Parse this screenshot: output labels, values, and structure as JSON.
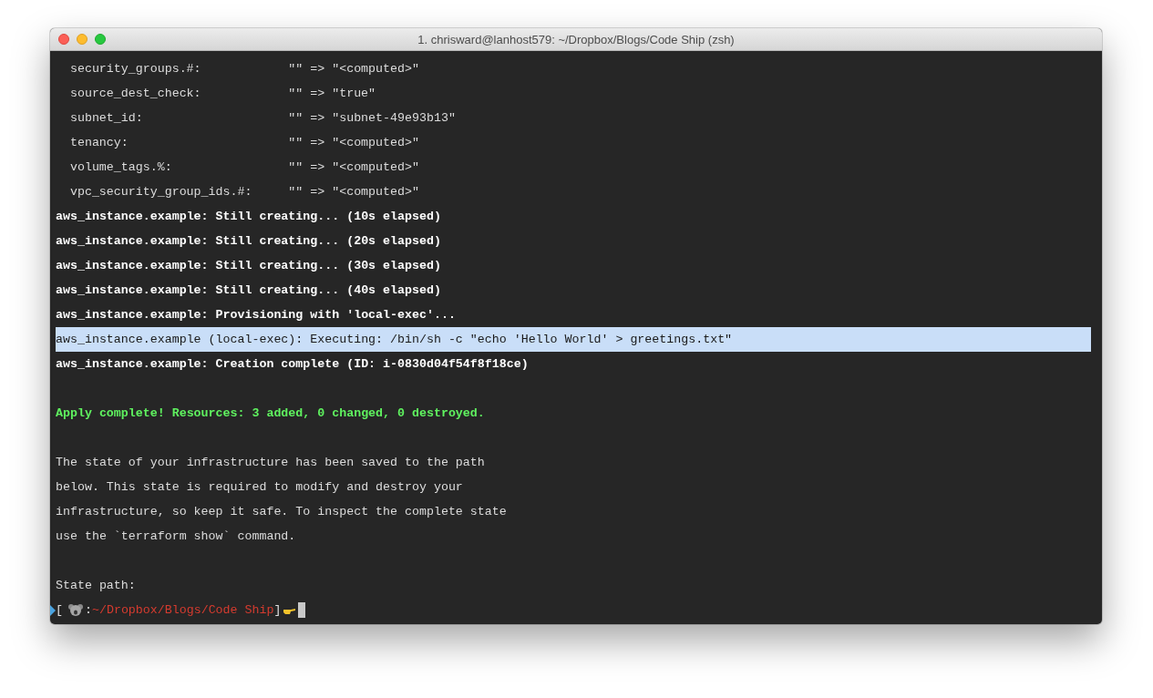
{
  "window": {
    "title": "1. chrisward@lanhost579: ~/Dropbox/Blogs/Code Ship (zsh)"
  },
  "lines": [
    {
      "kind": "attr",
      "key": "security_groups.#:",
      "value": "\"\" => \"<computed>\"",
      "selected": false
    },
    {
      "kind": "attr",
      "key": "source_dest_check:",
      "value": "\"\" => \"true\"",
      "selected": false
    },
    {
      "kind": "attr",
      "key": "subnet_id:",
      "value": "\"\" => \"subnet-49e93b13\"",
      "selected": false
    },
    {
      "kind": "attr",
      "key": "tenancy:",
      "value": "\"\" => \"<computed>\"",
      "selected": false
    },
    {
      "kind": "attr",
      "key": "volume_tags.%:",
      "value": "\"\" => \"<computed>\"",
      "selected": false
    },
    {
      "kind": "attr",
      "key": "vpc_security_group_ids.#:",
      "value": "\"\" => \"<computed>\"",
      "selected": false
    },
    {
      "kind": "bold",
      "text": "aws_instance.example: Still creating... (10s elapsed)",
      "selected": false
    },
    {
      "kind": "bold",
      "text": "aws_instance.example: Still creating... (20s elapsed)",
      "selected": false
    },
    {
      "kind": "bold",
      "text": "aws_instance.example: Still creating... (30s elapsed)",
      "selected": false
    },
    {
      "kind": "bold",
      "text": "aws_instance.example: Still creating... (40s elapsed)",
      "selected": false
    },
    {
      "kind": "bold",
      "text": "aws_instance.example: Provisioning with 'local-exec'...",
      "selected": false
    },
    {
      "kind": "plain",
      "text": "aws_instance.example (local-exec): Executing: /bin/sh -c \"echo 'Hello World' > greetings.txt\"",
      "selected": true
    },
    {
      "kind": "bold",
      "text": "aws_instance.example: Creation complete (ID: i-0830d04f54f8f18ce)",
      "selected": false
    },
    {
      "kind": "blank",
      "selected": false
    },
    {
      "kind": "success",
      "text": "Apply complete! Resources: 3 added, 0 changed, 0 destroyed.",
      "selected": false
    },
    {
      "kind": "blank",
      "selected": false
    },
    {
      "kind": "plain",
      "text": "The state of your infrastructure has been saved to the path",
      "selected": false
    },
    {
      "kind": "plain",
      "text": "below. This state is required to modify and destroy your",
      "selected": false
    },
    {
      "kind": "plain",
      "text": "infrastructure, so keep it safe. To inspect the complete state",
      "selected": false
    },
    {
      "kind": "plain",
      "text": "use the `terraform show` command.",
      "selected": false
    },
    {
      "kind": "blank",
      "selected": false
    },
    {
      "kind": "plain",
      "text": "State path:",
      "selected": false
    }
  ],
  "prompt": {
    "open": "[",
    "separator": ":",
    "path": "~/Dropbox/Blogs/Code Ship",
    "close": "]"
  }
}
